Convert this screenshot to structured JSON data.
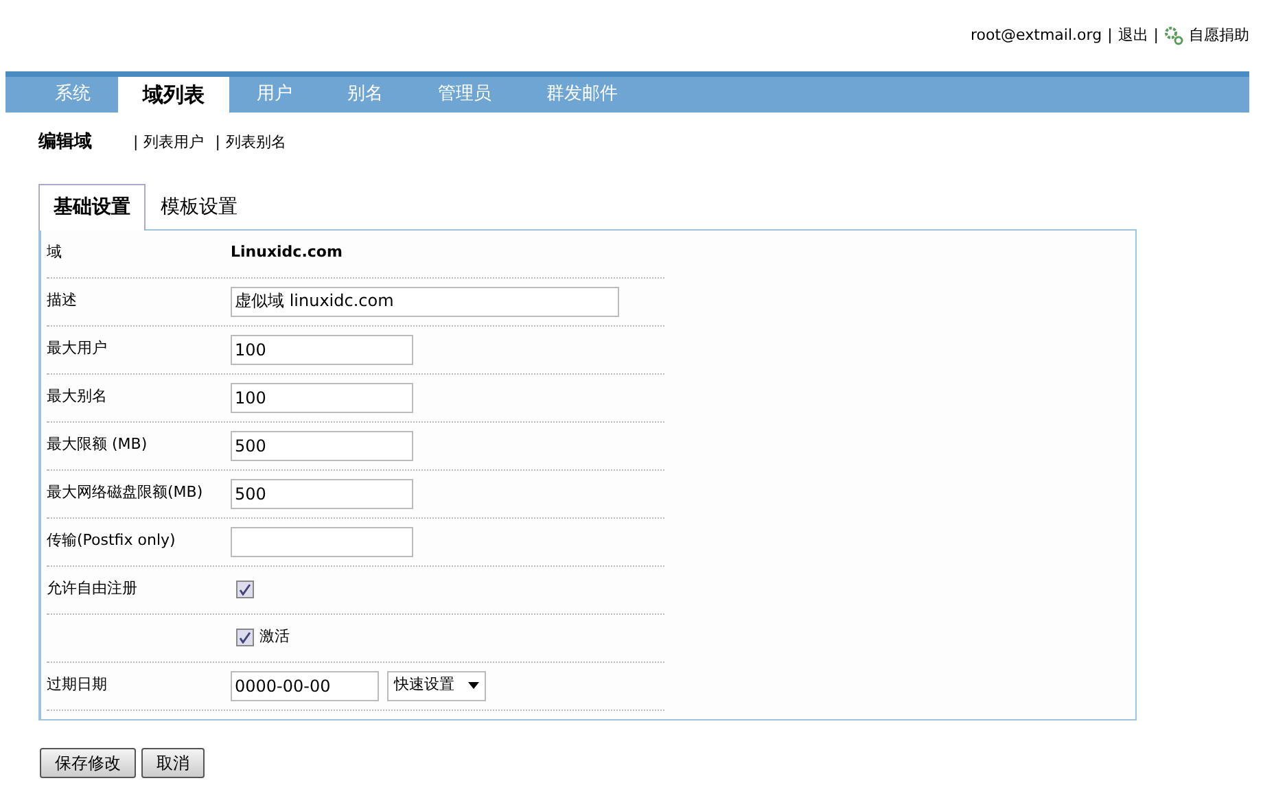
{
  "header": {
    "user": "root@extmail.org",
    "separator_1": "|",
    "logout": "退出",
    "separator_2": "|",
    "donate": "自愿捐助"
  },
  "menu": [
    {
      "label": "系统",
      "selected": false
    },
    {
      "label": "域列表",
      "selected": true
    },
    {
      "label": "用户",
      "selected": false
    },
    {
      "label": "别名",
      "selected": false
    },
    {
      "label": "管理员",
      "selected": false
    },
    {
      "label": "群发邮件",
      "selected": false
    }
  ],
  "subnav": {
    "title": "编辑域",
    "links": [
      {
        "separator": "|",
        "label": "列表用户"
      },
      {
        "separator": "|",
        "label": "列表别名"
      }
    ]
  },
  "tabs": [
    {
      "label": "基础设置",
      "selected": true
    },
    {
      "label": "模板设置",
      "selected": false
    }
  ],
  "fields": [
    {
      "kind": "static",
      "label": "域",
      "value": "Linuxidc.com"
    },
    {
      "kind": "text",
      "label": "描述",
      "value": "虚似域 linuxidc.com",
      "wide": true
    },
    {
      "kind": "text",
      "label": "最大用户",
      "value": "100"
    },
    {
      "kind": "text",
      "label": "最大别名",
      "value": "100"
    },
    {
      "kind": "text",
      "label": "最大限额 (MB)",
      "value": "500"
    },
    {
      "kind": "text",
      "label": "最大网络磁盘限额(MB)",
      "value": "500"
    },
    {
      "kind": "text",
      "label": "传输(Postfix only)"
    },
    {
      "kind": "checkbox",
      "label": "允许自由注册",
      "checked": true
    },
    {
      "kind": "checkbox",
      "option": "激活",
      "checked": true
    },
    {
      "kind": "date",
      "label": "过期日期",
      "value": "0000-00-00",
      "select": "快速设置"
    }
  ],
  "buttons": [
    "保存修改",
    "取消"
  ]
}
